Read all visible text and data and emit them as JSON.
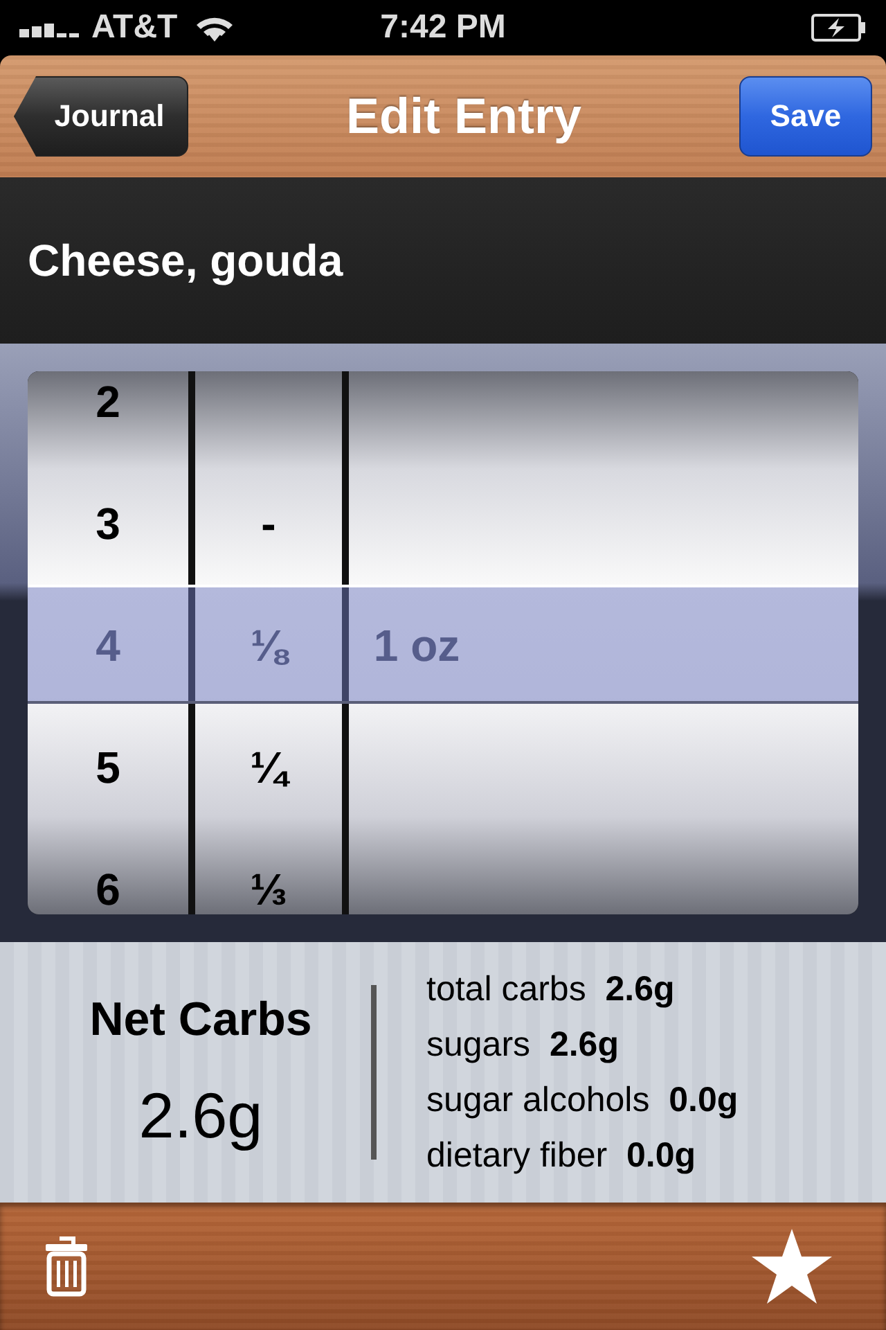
{
  "status_bar": {
    "carrier": "AT&T",
    "time": "7:42 PM"
  },
  "nav_bar": {
    "back_button": "Journal",
    "title": "Edit Entry",
    "save_button": "Save"
  },
  "food_name": "Cheese, gouda",
  "picker": {
    "wheels": [
      {
        "kind": "number",
        "items": [
          {
            "label": "2",
            "selected": false
          },
          {
            "label": "3",
            "selected": false
          },
          {
            "label": "4",
            "selected": true
          },
          {
            "label": "5",
            "selected": false
          },
          {
            "label": "6",
            "selected": false
          }
        ]
      },
      {
        "kind": "fraction",
        "items": [
          {
            "label": "-",
            "selected": false
          },
          {
            "label": "⅛",
            "selected": true
          },
          {
            "label": "¼",
            "selected": false
          },
          {
            "label": "⅓",
            "selected": false
          }
        ]
      },
      {
        "kind": "unit",
        "items": [
          {
            "label": "1 oz",
            "selected": true
          }
        ]
      }
    ]
  },
  "summary": {
    "net_carbs_label": "Net Carbs",
    "net_carbs_value": "2.6g",
    "nutrients": [
      {
        "label": "total carbs",
        "value": "2.6g"
      },
      {
        "label": "sugars",
        "value": "2.6g"
      },
      {
        "label": "sugar alcohols",
        "value": "0.0g"
      },
      {
        "label": "dietary fiber",
        "value": "0.0g"
      }
    ]
  }
}
